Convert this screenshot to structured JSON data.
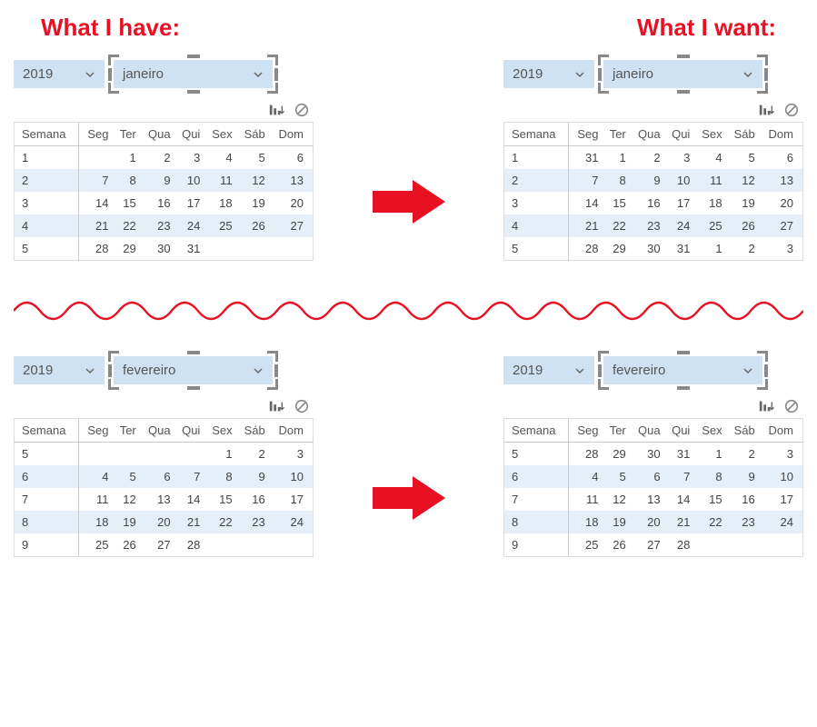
{
  "titles": {
    "left": "What I have:",
    "right": "What I want:"
  },
  "colors": {
    "accent": "#e81123",
    "dropdown_bg": "#cfe2f3"
  },
  "headers": [
    "Semana",
    "Seg",
    "Ter",
    "Qua",
    "Qui",
    "Sex",
    "Sáb",
    "Dom"
  ],
  "blocks": [
    {
      "year": "2019",
      "month": "janeiro",
      "left": {
        "rows": [
          [
            "1",
            "",
            "1",
            "2",
            "3",
            "4",
            "5",
            "6"
          ],
          [
            "2",
            "7",
            "8",
            "9",
            "10",
            "11",
            "12",
            "13"
          ],
          [
            "3",
            "14",
            "15",
            "16",
            "17",
            "18",
            "19",
            "20"
          ],
          [
            "4",
            "21",
            "22",
            "23",
            "24",
            "25",
            "26",
            "27"
          ],
          [
            "5",
            "28",
            "29",
            "30",
            "31",
            "",
            "",
            ""
          ]
        ]
      },
      "right": {
        "rows": [
          [
            "1",
            "31",
            "1",
            "2",
            "3",
            "4",
            "5",
            "6"
          ],
          [
            "2",
            "7",
            "8",
            "9",
            "10",
            "11",
            "12",
            "13"
          ],
          [
            "3",
            "14",
            "15",
            "16",
            "17",
            "18",
            "19",
            "20"
          ],
          [
            "4",
            "21",
            "22",
            "23",
            "24",
            "25",
            "26",
            "27"
          ],
          [
            "5",
            "28",
            "29",
            "30",
            "31",
            "1",
            "2",
            "3"
          ]
        ]
      }
    },
    {
      "year": "2019",
      "month": "fevereiro",
      "left": {
        "rows": [
          [
            "5",
            "",
            "",
            "",
            "",
            "1",
            "2",
            "3"
          ],
          [
            "6",
            "4",
            "5",
            "6",
            "7",
            "8",
            "9",
            "10"
          ],
          [
            "7",
            "11",
            "12",
            "13",
            "14",
            "15",
            "16",
            "17"
          ],
          [
            "8",
            "18",
            "19",
            "20",
            "21",
            "22",
            "23",
            "24"
          ],
          [
            "9",
            "25",
            "26",
            "27",
            "28",
            "",
            "",
            ""
          ]
        ]
      },
      "right": {
        "rows": [
          [
            "5",
            "28",
            "29",
            "30",
            "31",
            "1",
            "2",
            "3"
          ],
          [
            "6",
            "4",
            "5",
            "6",
            "7",
            "8",
            "9",
            "10"
          ],
          [
            "7",
            "11",
            "12",
            "13",
            "14",
            "15",
            "16",
            "17"
          ],
          [
            "8",
            "18",
            "19",
            "20",
            "21",
            "22",
            "23",
            "24"
          ],
          [
            "9",
            "25",
            "26",
            "27",
            "28",
            "",
            "",
            ""
          ]
        ]
      }
    }
  ]
}
